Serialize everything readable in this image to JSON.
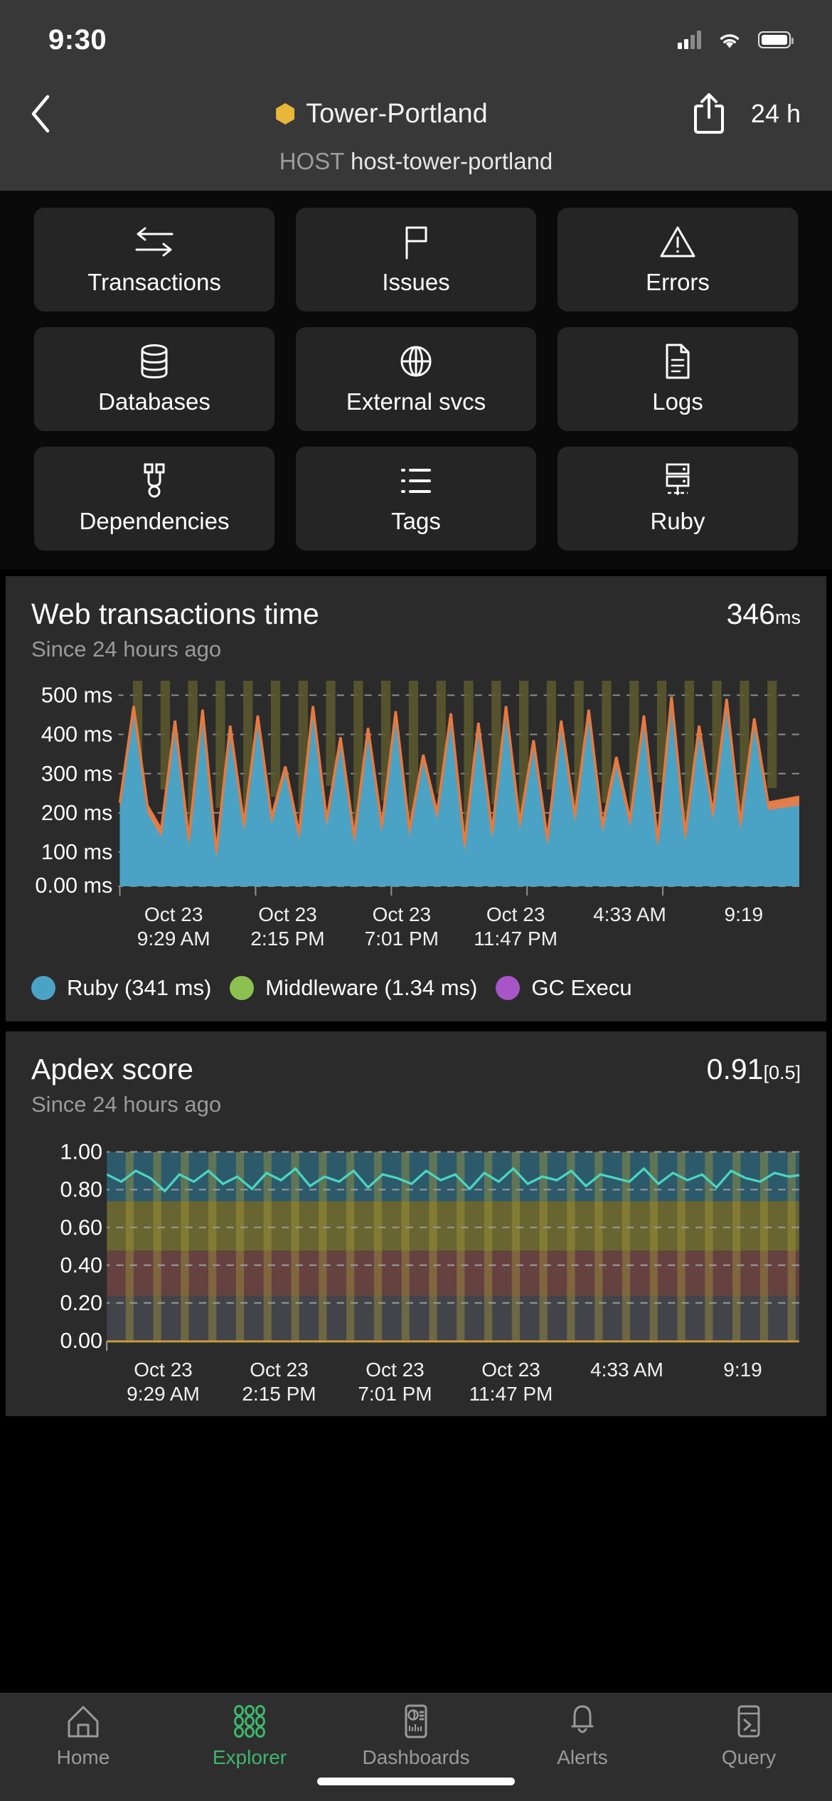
{
  "status_bar": {
    "time": "9:30",
    "cellular_icon": "cellular-signal-icon",
    "wifi_icon": "wifi-icon",
    "battery_icon": "battery-icon"
  },
  "header": {
    "back_icon": "chevron-left-icon",
    "entity_badge_icon": "hexagon-badge-icon",
    "entity_badge_color": "#e8b73a",
    "title": "Tower-Portland",
    "share_icon": "share-icon",
    "time_range": "24 h",
    "host_label": "HOST",
    "host_value": "host-tower-portland"
  },
  "tiles": [
    {
      "label": "Transactions",
      "icon": "transactions-arrows-icon"
    },
    {
      "label": "Issues",
      "icon": "flag-icon"
    },
    {
      "label": "Errors",
      "icon": "warning-triangle-icon"
    },
    {
      "label": "Databases",
      "icon": "database-icon"
    },
    {
      "label": "External svcs",
      "icon": "globe-icon"
    },
    {
      "label": "Logs",
      "icon": "document-icon"
    },
    {
      "label": "Dependencies",
      "icon": "dependencies-icon"
    },
    {
      "label": "Tags",
      "icon": "list-icon"
    },
    {
      "label": "Ruby",
      "icon": "server-stack-icon"
    }
  ],
  "cards": [
    {
      "title": "Web transactions time",
      "subtitle": "Since 24 hours ago",
      "value": "346",
      "unit": "ms"
    },
    {
      "title": "Apdex score",
      "subtitle": "Since 24 hours ago",
      "value": "0.91",
      "threshold": "[0.5]"
    }
  ],
  "tab_bar": {
    "items": [
      {
        "label": "Home",
        "icon": "home-icon",
        "active": false
      },
      {
        "label": "Explorer",
        "icon": "explorer-dots-icon",
        "active": true
      },
      {
        "label": "Dashboards",
        "icon": "dashboard-icon",
        "active": false
      },
      {
        "label": "Alerts",
        "icon": "bell-icon",
        "active": false
      },
      {
        "label": "Query",
        "icon": "terminal-icon",
        "active": false
      }
    ],
    "active_color": "#3fb56c",
    "inactive_color": "#9a9a9a"
  },
  "chart_data": [
    {
      "type": "area",
      "title": "Web transactions time",
      "subtitle": "Since 24 hours ago",
      "summary_value": 346,
      "summary_unit": "ms",
      "xlabel": "",
      "ylabel": "",
      "ylim": [
        0,
        550
      ],
      "grid": true,
      "legend_position": "bottom",
      "ytick_labels": [
        "500 ms",
        "400 ms",
        "300 ms",
        "200 ms",
        "100 ms",
        "0.00 ms"
      ],
      "ytick_values": [
        500,
        400,
        300,
        200,
        100,
        0
      ],
      "xtick_labels": [
        [
          "Oct 23",
          "9:29 AM"
        ],
        [
          "Oct 23",
          "2:15 PM"
        ],
        [
          "Oct 23",
          "7:01 PM"
        ],
        [
          "Oct 23",
          "11:47 PM"
        ],
        [
          "4:33 AM",
          ""
        ],
        [
          "9:19",
          ""
        ]
      ],
      "legend": [
        {
          "name": "Ruby (341 ms)",
          "color": "#4aa3c4"
        },
        {
          "name": "Middleware (1.34 ms)",
          "color": "#8cc152"
        },
        {
          "name": "GC Execu",
          "color": "#a855c8"
        }
      ],
      "series": [
        {
          "name": "Ruby",
          "color": "#4aa3c4",
          "values": [
            210,
            430,
            205,
            150,
            400,
            130,
            420,
            100,
            390,
            160,
            410,
            175,
            300,
            140,
            430,
            165,
            365,
            130,
            380,
            155,
            420,
            150,
            340,
            180,
            410,
            120,
            395,
            145,
            430,
            160,
            370,
            135,
            400,
            170,
            425,
            150,
            340,
            165,
            415,
            130,
            460,
            140,
            390,
            175,
            455,
            160,
            415,
            210
          ]
        },
        {
          "name": "Middleware",
          "color": "#e08050",
          "values": [
            225,
            448,
            220,
            165,
            418,
            145,
            438,
            115,
            408,
            175,
            428,
            190,
            318,
            155,
            448,
            180,
            383,
            145,
            398,
            170,
            438,
            165,
            358,
            195,
            428,
            135,
            413,
            160,
            448,
            175,
            388,
            150,
            418,
            185,
            443,
            165,
            358,
            180,
            433,
            145,
            478,
            155,
            408,
            190,
            473,
            175,
            433,
            225
          ]
        }
      ]
    },
    {
      "type": "area",
      "title": "Apdex score",
      "subtitle": "Since 24 hours ago",
      "summary_value": 0.91,
      "threshold": 0.5,
      "xlabel": "",
      "ylabel": "",
      "ylim": [
        0,
        1.08
      ],
      "grid": true,
      "legend_position": "bottom",
      "ytick_labels": [
        "1.00",
        "0.80",
        "0.60",
        "0.40",
        "0.20",
        "0.00"
      ],
      "ytick_values": [
        1.0,
        0.8,
        0.6,
        0.4,
        0.2,
        0.0
      ],
      "xtick_labels": [
        [
          "Oct 23",
          "9:29 AM"
        ],
        [
          "Oct 23",
          "2:15 PM"
        ],
        [
          "Oct 23",
          "7:01 PM"
        ],
        [
          "Oct 23",
          "11:47 PM"
        ],
        [
          "4:33 AM",
          ""
        ],
        [
          "9:19",
          ""
        ]
      ],
      "series": [
        {
          "name": "Apdex",
          "color": "#4ad6c0",
          "values": [
            0.88,
            0.84,
            0.9,
            0.86,
            0.79,
            0.88,
            0.84,
            0.9,
            0.83,
            0.87,
            0.8,
            0.89,
            0.85,
            0.91,
            0.82,
            0.87,
            0.84,
            0.9,
            0.81,
            0.88,
            0.86,
            0.83,
            0.9,
            0.85,
            0.88,
            0.8,
            0.89,
            0.84,
            0.91,
            0.83,
            0.87,
            0.85,
            0.9,
            0.82,
            0.88,
            0.86,
            0.84,
            0.91,
            0.83,
            0.89,
            0.85,
            0.88,
            0.81,
            0.9,
            0.86,
            0.84,
            0.89,
            0.87
          ]
        }
      ]
    }
  ]
}
